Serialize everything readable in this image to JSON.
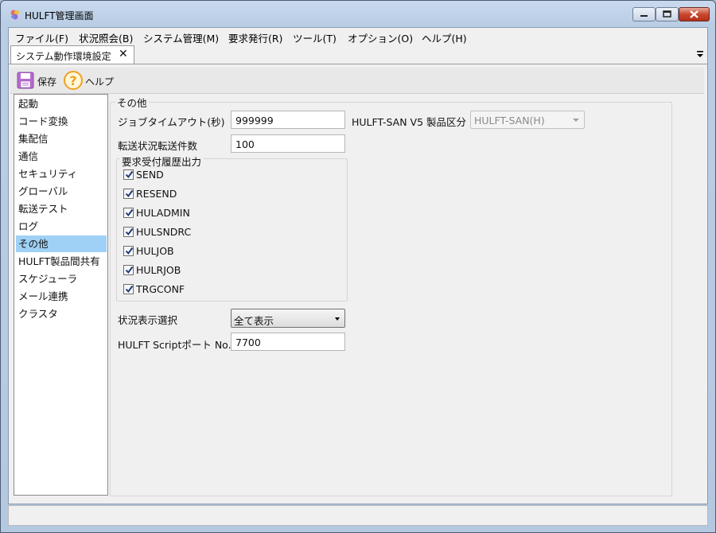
{
  "window": {
    "title": "HULFT管理画面"
  },
  "menu": [
    "ファイル(F)",
    "状況照会(B)",
    "システム管理(M)",
    "要求発行(R)",
    "ツール(T)",
    "オプション(O)",
    "ヘルプ(H)"
  ],
  "tab": {
    "label": "システム動作環境設定",
    "close": "✕"
  },
  "toolbar": {
    "save_label": "保存",
    "help_label": "ヘルプ"
  },
  "nav": {
    "items": [
      "起動",
      "コード変換",
      "集配信",
      "通信",
      "セキュリティ",
      "グローバル",
      "転送テスト",
      "ログ",
      "その他",
      "HULFT製品間共有",
      "スケジューラ",
      "メール連携",
      "クラスタ"
    ],
    "selected": "その他"
  },
  "form": {
    "group_title": "その他",
    "job_timeout": {
      "label": "ジョブタイムアウト(秒)",
      "value": "999999"
    },
    "san": {
      "label": "HULFT-SAN V5 製品区分",
      "value": "HULFT-SAN(H)"
    },
    "transfer_count": {
      "label": "転送状況転送件数",
      "value": "100"
    },
    "history_group": {
      "title": "要求受付履歴出力",
      "items": [
        {
          "label": "SEND",
          "checked": true
        },
        {
          "label": "RESEND",
          "checked": true
        },
        {
          "label": "HULADMIN",
          "checked": true
        },
        {
          "label": "HULSNDRC",
          "checked": true
        },
        {
          "label": "HULJOB",
          "checked": true
        },
        {
          "label": "HULRJOB",
          "checked": true
        },
        {
          "label": "TRGCONF",
          "checked": true
        }
      ]
    },
    "status_display": {
      "label": "状況表示選択",
      "value": "全て表示"
    },
    "script_port": {
      "label": "HULFT Scriptポート No.",
      "value": "7700"
    }
  }
}
